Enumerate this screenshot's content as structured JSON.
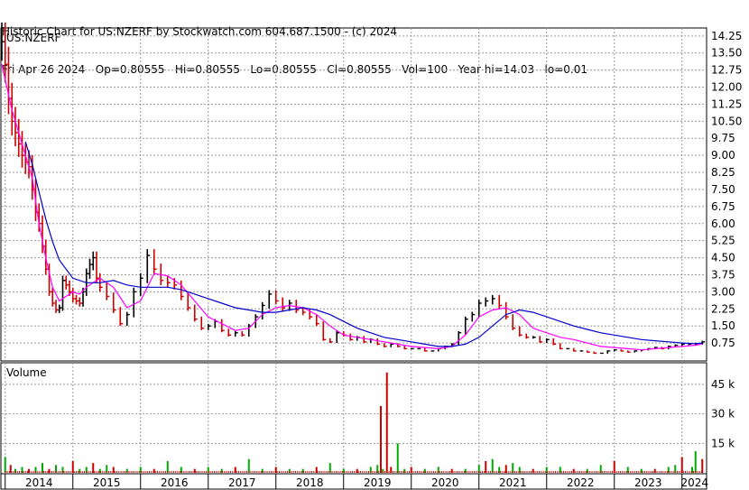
{
  "header": {
    "line1": "Historic Chart for US:NZERF by Stockwatch.com 604.687.1500 - (c) 2024",
    "line2": "Fri Apr 26 2024   Op=0.80555   Hi=0.80555   Lo=0.80555   Cl=0.80555   Vol=100   Year hi=14.03   lo=0.01"
  },
  "chart_data": [
    {
      "type": "bar",
      "title": "US:NZERF",
      "price_axis_range": [
        0,
        14.6
      ],
      "y_ticks": [
        "14.25",
        "13.50",
        "12.75",
        "12.00",
        "11.25",
        "10.50",
        "9.75",
        "9.00",
        "8.25",
        "7.50",
        "6.75",
        "6.00",
        "5.25",
        "4.50",
        "3.75",
        "3.00",
        "2.25",
        "1.50",
        "0.75"
      ],
      "y_tick_values": [
        14.25,
        13.5,
        12.75,
        12.0,
        11.25,
        10.5,
        9.75,
        9.0,
        8.25,
        7.5,
        6.75,
        6.0,
        5.25,
        4.5,
        3.75,
        3.0,
        2.25,
        1.5,
        0.75
      ],
      "x_ticks": [
        "2014",
        "2015",
        "2016",
        "2017",
        "2018",
        "2019",
        "2020",
        "2021",
        "2022",
        "2023",
        "2024"
      ],
      "x_tick_values": [
        2014.0,
        2015.0,
        2016.0,
        2017.0,
        2018.0,
        2019.0,
        2020.0,
        2021.0,
        2022.0,
        2023.0,
        2024.0
      ],
      "x_range": [
        2013.95,
        2024.35
      ],
      "grid": true,
      "series": [
        {
          "kind": "price",
          "x": [
            2013.95,
            2014.0,
            2014.05,
            2014.1,
            2014.15,
            2014.2,
            2014.25,
            2014.3,
            2014.35,
            2014.4,
            2014.45,
            2014.5,
            2014.55,
            2014.6,
            2014.65,
            2014.7,
            2014.75,
            2014.8,
            2014.85,
            2014.9,
            2014.95,
            2015.0,
            2015.05,
            2015.1,
            2015.15,
            2015.2,
            2015.25,
            2015.3,
            2015.35,
            2015.4,
            2015.5,
            2015.6,
            2015.7,
            2015.8,
            2015.9,
            2016.0,
            2016.1,
            2016.2,
            2016.3,
            2016.4,
            2016.5,
            2016.6,
            2016.7,
            2016.8,
            2016.9,
            2017.0,
            2017.1,
            2017.2,
            2017.3,
            2017.4,
            2017.5,
            2017.6,
            2017.7,
            2017.8,
            2017.9,
            2018.0,
            2018.1,
            2018.2,
            2018.3,
            2018.4,
            2018.5,
            2018.6,
            2018.7,
            2018.8,
            2018.9,
            2019.0,
            2019.1,
            2019.2,
            2019.3,
            2019.4,
            2019.5,
            2019.6,
            2019.7,
            2019.8,
            2019.9,
            2020.0,
            2020.1,
            2020.2,
            2020.3,
            2020.4,
            2020.5,
            2020.6,
            2020.7,
            2020.8,
            2020.9,
            2021.0,
            2021.1,
            2021.2,
            2021.3,
            2021.4,
            2021.5,
            2021.6,
            2021.7,
            2021.8,
            2021.9,
            2022.0,
            2022.1,
            2022.2,
            2022.3,
            2022.4,
            2022.5,
            2022.6,
            2022.7,
            2022.8,
            2022.9,
            2023.0,
            2023.1,
            2023.2,
            2023.3,
            2023.4,
            2023.5,
            2023.6,
            2023.7,
            2023.8,
            2023.9,
            2024.0,
            2024.1,
            2024.2,
            2024.3
          ],
          "close": [
            14.0,
            13.0,
            11.5,
            10.5,
            10.0,
            9.5,
            9.0,
            8.7,
            8.5,
            7.5,
            6.5,
            6.0,
            5.0,
            4.0,
            3.0,
            2.5,
            2.2,
            2.3,
            3.5,
            3.3,
            3.0,
            2.7,
            2.6,
            2.5,
            3.0,
            3.8,
            4.2,
            4.5,
            3.6,
            3.2,
            2.8,
            2.2,
            1.6,
            2.0,
            3.0,
            3.6,
            4.6,
            4.0,
            3.5,
            3.4,
            3.3,
            2.8,
            2.3,
            1.8,
            1.4,
            1.5,
            1.7,
            1.3,
            1.1,
            1.2,
            1.1,
            1.5,
            1.9,
            2.4,
            2.9,
            2.6,
            2.3,
            2.5,
            2.2,
            2.1,
            1.9,
            1.6,
            0.9,
            0.8,
            1.2,
            1.1,
            0.9,
            1.0,
            0.8,
            0.9,
            0.7,
            0.6,
            0.7,
            0.6,
            0.5,
            0.5,
            0.5,
            0.4,
            0.4,
            0.5,
            0.6,
            0.7,
            1.2,
            1.8,
            2.0,
            2.5,
            2.6,
            2.7,
            2.4,
            1.9,
            1.4,
            1.1,
            1.0,
            1.0,
            0.8,
            0.9,
            0.7,
            0.5,
            0.5,
            0.4,
            0.4,
            0.35,
            0.3,
            0.3,
            0.4,
            0.45,
            0.4,
            0.35,
            0.4,
            0.45,
            0.5,
            0.55,
            0.5,
            0.6,
            0.65,
            0.7,
            0.7,
            0.72,
            0.8
          ]
        },
        {
          "kind": "moving_average_short",
          "color": "#ff00ff",
          "x": [
            2013.95,
            2014.1,
            2014.2,
            2014.3,
            2014.4,
            2014.5,
            2014.6,
            2014.7,
            2014.8,
            2014.9,
            2015.0,
            2015.1,
            2015.2,
            2015.3,
            2015.4,
            2015.6,
            2015.8,
            2016.0,
            2016.2,
            2016.4,
            2016.6,
            2016.8,
            2017.0,
            2017.2,
            2017.4,
            2017.6,
            2017.8,
            2018.0,
            2018.2,
            2018.4,
            2018.6,
            2018.8,
            2019.0,
            2019.2,
            2019.4,
            2019.6,
            2019.8,
            2020.0,
            2020.2,
            2020.4,
            2020.6,
            2020.8,
            2021.0,
            2021.2,
            2021.4,
            2021.6,
            2021.8,
            2022.0,
            2022.2,
            2022.4,
            2022.6,
            2022.8,
            2023.0,
            2023.2,
            2023.4,
            2023.6,
            2023.8,
            2024.0,
            2024.2,
            2024.3
          ],
          "values": [
            13.0,
            11.0,
            10.0,
            9.0,
            8.0,
            6.0,
            4.5,
            3.2,
            2.6,
            2.8,
            3.0,
            2.9,
            3.2,
            3.4,
            3.6,
            3.2,
            2.3,
            2.6,
            3.8,
            3.7,
            3.3,
            2.6,
            1.9,
            1.6,
            1.3,
            1.4,
            2.0,
            2.3,
            2.4,
            2.3,
            2.0,
            1.5,
            1.1,
            1.0,
            0.9,
            0.8,
            0.7,
            0.6,
            0.55,
            0.5,
            0.6,
            1.1,
            1.9,
            2.2,
            2.3,
            2.0,
            1.4,
            1.2,
            1.0,
            0.9,
            0.75,
            0.6,
            0.55,
            0.5,
            0.45,
            0.5,
            0.55,
            0.6,
            0.65,
            0.72
          ]
        },
        {
          "kind": "moving_average_long",
          "color": "#0000cc",
          "x": [
            2014.3,
            2014.4,
            2014.5,
            2014.6,
            2014.7,
            2014.8,
            2015.0,
            2015.2,
            2015.4,
            2015.6,
            2015.8,
            2016.0,
            2016.2,
            2016.4,
            2016.6,
            2016.8,
            2017.0,
            2017.2,
            2017.4,
            2017.6,
            2017.8,
            2018.0,
            2018.2,
            2018.4,
            2018.6,
            2018.8,
            2019.0,
            2019.2,
            2019.4,
            2019.6,
            2019.8,
            2020.0,
            2020.2,
            2020.4,
            2020.6,
            2020.8,
            2021.0,
            2021.2,
            2021.4,
            2021.6,
            2021.8,
            2022.0,
            2022.2,
            2022.4,
            2022.6,
            2022.8,
            2023.0,
            2023.2,
            2023.4,
            2023.6,
            2023.8,
            2024.0,
            2024.2,
            2024.3
          ],
          "values": [
            9.6,
            8.6,
            7.4,
            6.2,
            5.2,
            4.4,
            3.6,
            3.4,
            3.4,
            3.5,
            3.3,
            3.2,
            3.2,
            3.2,
            3.1,
            2.9,
            2.7,
            2.5,
            2.3,
            2.2,
            2.1,
            2.1,
            2.2,
            2.3,
            2.2,
            2.0,
            1.7,
            1.4,
            1.2,
            1.0,
            0.9,
            0.8,
            0.7,
            0.6,
            0.6,
            0.7,
            1.0,
            1.5,
            2.0,
            2.2,
            2.1,
            1.9,
            1.7,
            1.5,
            1.35,
            1.2,
            1.1,
            1.0,
            0.9,
            0.85,
            0.8,
            0.75,
            0.72,
            0.75
          ]
        }
      ]
    },
    {
      "type": "bar",
      "title": "Volume",
      "volume_axis_range": [
        0,
        56
      ],
      "y_ticks": [
        "45 k",
        "30 k",
        "15 k"
      ],
      "y_tick_values": [
        45,
        30,
        15
      ],
      "series": [
        {
          "name": "Volume",
          "x": [
            2014.0,
            2014.08,
            2014.15,
            2014.25,
            2014.35,
            2014.45,
            2014.55,
            2014.65,
            2014.75,
            2014.85,
            2015.0,
            2015.1,
            2015.2,
            2015.3,
            2015.4,
            2015.5,
            2015.6,
            2015.8,
            2016.0,
            2016.2,
            2016.4,
            2016.6,
            2016.8,
            2017.0,
            2017.2,
            2017.4,
            2017.6,
            2017.8,
            2018.0,
            2018.2,
            2018.4,
            2018.6,
            2018.8,
            2019.0,
            2019.2,
            2019.4,
            2019.5,
            2019.55,
            2019.58,
            2019.64,
            2019.7,
            2019.8,
            2019.9,
            2020.0,
            2020.2,
            2020.4,
            2020.6,
            2020.8,
            2021.0,
            2021.1,
            2021.2,
            2021.3,
            2021.4,
            2021.5,
            2021.6,
            2021.8,
            2022.0,
            2022.2,
            2022.4,
            2022.6,
            2022.8,
            2023.0,
            2023.2,
            2023.4,
            2023.6,
            2023.8,
            2023.9,
            2024.0,
            2024.15,
            2024.2,
            2024.3
          ],
          "values": [
            8,
            4,
            2,
            3,
            2,
            3,
            5,
            2,
            4,
            3,
            6,
            2,
            3,
            5,
            2,
            4,
            3,
            2,
            3,
            2,
            6,
            3,
            2,
            3,
            2,
            3,
            7,
            2,
            3,
            2,
            2,
            3,
            5,
            2,
            2,
            3,
            4,
            34,
            2,
            51,
            3,
            15,
            2,
            3,
            2,
            3,
            2,
            2,
            4,
            6,
            7,
            3,
            4,
            5,
            3,
            2,
            3,
            3,
            2,
            2,
            4,
            6,
            3,
            2,
            2,
            3,
            4,
            8,
            3,
            11,
            7
          ]
        }
      ]
    }
  ]
}
